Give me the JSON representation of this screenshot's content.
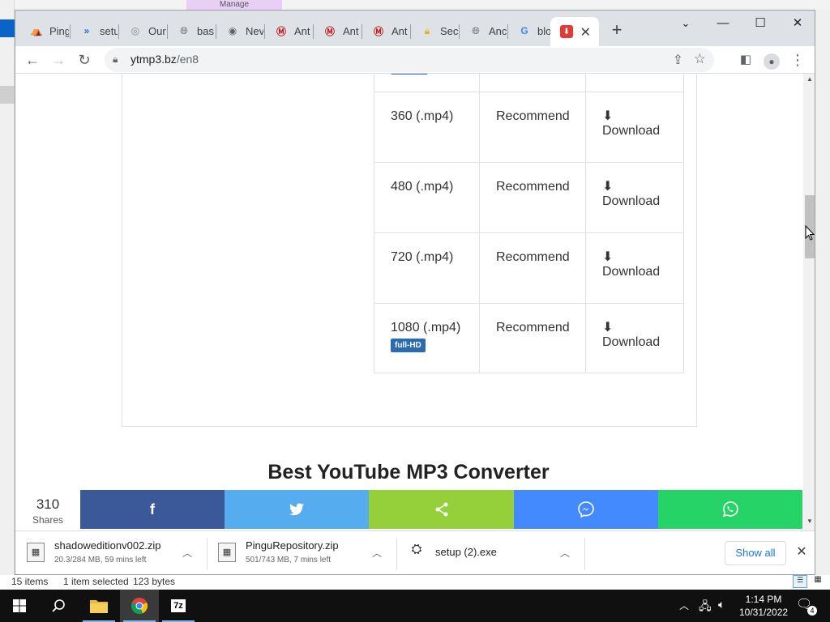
{
  "background": {
    "manage_label": "Manage"
  },
  "browser": {
    "tabs": [
      {
        "label": "Ping",
        "icon": "ping-icon"
      },
      {
        "label": "setu",
        "icon": "double-chevron-icon"
      },
      {
        "label": "Our",
        "icon": "globe-icon"
      },
      {
        "label": "bas",
        "icon": "globe-icon"
      },
      {
        "label": "Nev",
        "icon": "chrome-icon"
      },
      {
        "label": "Ant",
        "icon": "mcafee-icon"
      },
      {
        "label": "Ant",
        "icon": "mcafee-icon"
      },
      {
        "label": "Ant",
        "icon": "mcafee-icon"
      },
      {
        "label": "Sec",
        "icon": "lock-icon"
      },
      {
        "label": "Anc",
        "icon": "globe-icon"
      },
      {
        "label": "blo",
        "icon": "google-icon"
      },
      {
        "label": "",
        "icon": "ytmp3-icon",
        "active": true
      }
    ],
    "new_tab_label": "+",
    "url_host": "ytmp3.bz",
    "url_path": "/en8"
  },
  "page": {
    "rows": [
      {
        "quality": "360 (.mp4)",
        "recommend": "Recommend",
        "action": "Download",
        "badge": ""
      },
      {
        "quality": "480 (.mp4)",
        "recommend": "Recommend",
        "action": "Download",
        "badge": ""
      },
      {
        "quality": "720 (.mp4)",
        "recommend": "Recommend",
        "action": "Download",
        "badge": ""
      },
      {
        "quality": "1080 (.mp4)",
        "recommend": "Recommend",
        "action": "Download",
        "badge": "full-HD"
      }
    ],
    "section_title": "Best YouTube MP3 Converter"
  },
  "sharebar": {
    "count": "310",
    "count_label": "Shares",
    "buttons": [
      {
        "name": "facebook",
        "glyph": "f",
        "color": "#3b5998"
      },
      {
        "name": "twitter",
        "glyph": "🐦",
        "color": "#55acee"
      },
      {
        "name": "sharethis",
        "glyph": "⋖",
        "color": "#95d03a"
      },
      {
        "name": "messenger",
        "glyph": "◯",
        "color": "#448aff"
      },
      {
        "name": "whatsapp",
        "glyph": "◯",
        "color": "#25d366"
      }
    ]
  },
  "downloads": {
    "items": [
      {
        "name": "shadoweditionv002.zip",
        "status": "20.3/284 MB, 59 mins left"
      },
      {
        "name": "PinguRepository.zip",
        "status": "501/743 MB, 7 mins left"
      },
      {
        "name": "setup (2).exe",
        "status": ""
      }
    ],
    "show_all_label": "Show all"
  },
  "explorer_status": {
    "items_count": "15 items",
    "selection": "1 item selected",
    "size": "123 bytes"
  },
  "taskbar": {
    "time": "1:14 PM",
    "date": "10/31/2022",
    "notification_count": "4",
    "sevenzip_label": "7z"
  }
}
